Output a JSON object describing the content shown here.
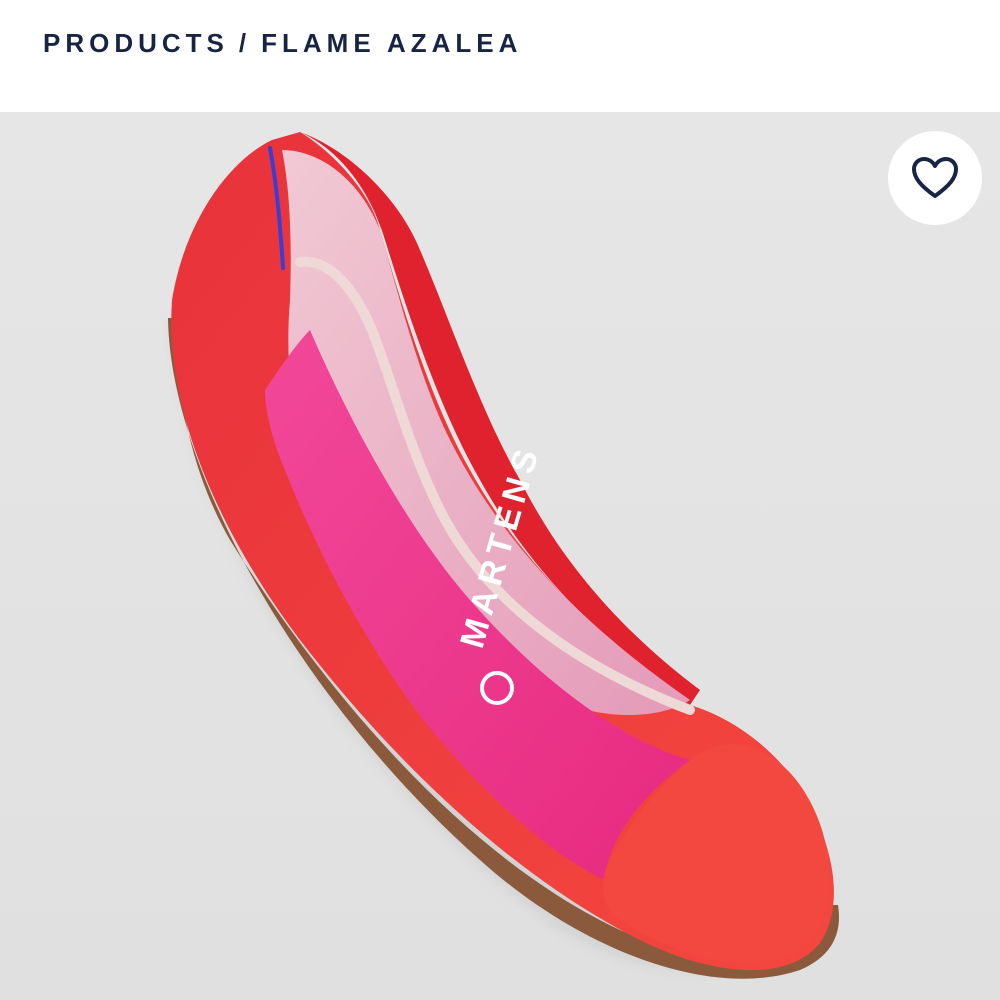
{
  "breadcrumb": {
    "root": "PRODUCTS",
    "separator": "/",
    "current": "FLAME AZALEA"
  },
  "product": {
    "insole_brand": "MARTENS",
    "colors": {
      "flame": "#f2353f",
      "azalea": "#f0348c",
      "lining": "#e8a9c1",
      "sole": "#8b5a3c"
    }
  },
  "favorite": {
    "icon": "heart-outline-icon",
    "color": "#172545"
  }
}
